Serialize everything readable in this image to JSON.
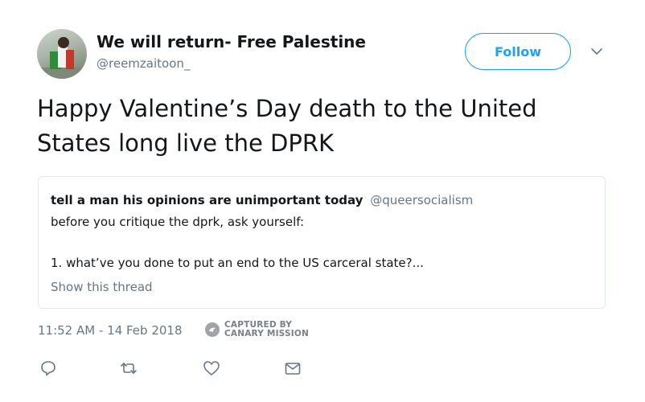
{
  "author": {
    "name": "We will return- Free Palestine",
    "handle": "@reemzaitoon_"
  },
  "follow_button": {
    "label": "Follow"
  },
  "tweet": {
    "text_line1": "Happy Valentine’s Day death to the United",
    "text_line2": "States long live the DPRK"
  },
  "quoted_tweet": {
    "name": "tell a man his opinions are unimportant today",
    "handle": "@queersocialism",
    "line1": "before you critique the dprk, ask yourself:",
    "line2": "1. what’ve you done to put an end to the US carceral state?...",
    "show_thread": "Show this thread"
  },
  "timestamp": "11:52 AM - 14 Feb 2018",
  "watermark": {
    "line1": "CAPTURED BY",
    "line2": "CANARY MISSION"
  },
  "actions": [
    {
      "icon": "reply-icon"
    },
    {
      "icon": "retweet-icon"
    },
    {
      "icon": "like-icon"
    },
    {
      "icon": "message-icon"
    }
  ],
  "colors": {
    "accent": "#1da1f2",
    "secondary_text": "#657786",
    "border": "#e1e8ed"
  }
}
